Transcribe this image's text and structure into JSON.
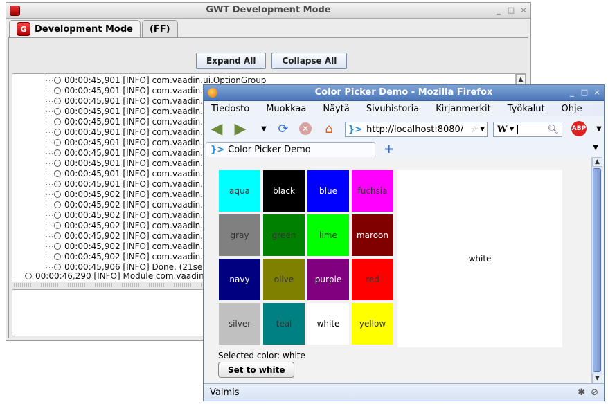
{
  "gwt": {
    "title": "GWT Development Mode",
    "tabs": [
      {
        "label": "Development Mode"
      },
      {
        "label": "(FF)"
      }
    ],
    "buttons": {
      "expand": "Expand All",
      "collapse": "Collapse All"
    },
    "log_lines": [
      "00:00:45,901  [INFO] com.vaadin.ui.OptionGroup",
      "00:00:45,901  [INFO] com.vaadin.",
      "00:00:45,901  [INFO] com.vaadin.",
      "00:00:45,901  [INFO] com.vaadin.",
      "00:00:45,901  [INFO] com.vaadin.",
      "00:00:45,901  [INFO] com.vaadin.",
      "00:00:45,901  [INFO] com.vaadin.",
      "00:00:45,901  [INFO] com.vaadin.",
      "00:00:45,901  [INFO] com.vaadin.",
      "00:00:45,901  [INFO] com.vaadin.",
      "00:00:45,901  [INFO] com.vaadin.",
      "00:00:45,902  [INFO] com.vaadin.",
      "00:00:45,902  [INFO] com.vaadin.",
      "00:00:45,902  [INFO] com.vaadin.",
      "00:00:45,902  [INFO] com.vaadin.",
      "00:00:45,902  [INFO] com.vaadin.",
      "00:00:45,902  [INFO] com.vaadin.",
      "00:00:45,902  [INFO] com.vaadin.",
      "00:00:45,906  [INFO] Done. (21se"
    ],
    "module_line": "00:00:46,290  [INFO] Module com.vaadin"
  },
  "firefox": {
    "title": "Color Picker Demo - Mozilla Firefox",
    "menu": [
      "Tiedosto",
      "Muokkaa",
      "Näytä",
      "Sivuhistoria",
      "Kirjanmerkit",
      "Työkalut",
      "Ohje"
    ],
    "url": "http://localhost:8080/",
    "search_engine": "W",
    "tab_title": "Color Picker Demo",
    "status": "Valmis",
    "icons": {
      "back": "back-arrow-icon",
      "forward": "forward-arrow-icon",
      "reload": "reload-icon",
      "stop": "stop-icon",
      "home": "home-icon",
      "bookmark": "star-icon",
      "adblock": "ABP",
      "new_tab": "plus-icon"
    }
  },
  "app": {
    "colors": [
      {
        "name": "aqua",
        "bg": "#00ffff",
        "fg": "#333333"
      },
      {
        "name": "black",
        "bg": "#000000",
        "fg": "#ffffff"
      },
      {
        "name": "blue",
        "bg": "#0000ff",
        "fg": "#ffffff"
      },
      {
        "name": "fuchsia",
        "bg": "#ff00ff",
        "fg": "#333333"
      },
      {
        "name": "gray",
        "bg": "#808080",
        "fg": "#333333"
      },
      {
        "name": "green",
        "bg": "#008000",
        "fg": "#333333"
      },
      {
        "name": "lime",
        "bg": "#00ff00",
        "fg": "#333333"
      },
      {
        "name": "maroon",
        "bg": "#800000",
        "fg": "#ffffff"
      },
      {
        "name": "navy",
        "bg": "#000080",
        "fg": "#ffffff"
      },
      {
        "name": "olive",
        "bg": "#808000",
        "fg": "#333333"
      },
      {
        "name": "purple",
        "bg": "#800080",
        "fg": "#ffffff"
      },
      {
        "name": "red",
        "bg": "#ff0000",
        "fg": "#333333"
      },
      {
        "name": "silver",
        "bg": "#c0c0c0",
        "fg": "#333333"
      },
      {
        "name": "teal",
        "bg": "#008080",
        "fg": "#333333"
      },
      {
        "name": "white",
        "bg": "#ffffff",
        "fg": "#000000"
      },
      {
        "name": "yellow",
        "bg": "#ffff00",
        "fg": "#333333"
      }
    ],
    "preview_label": "white",
    "selected_text": "Selected color: white",
    "set_button": "Set to white"
  }
}
